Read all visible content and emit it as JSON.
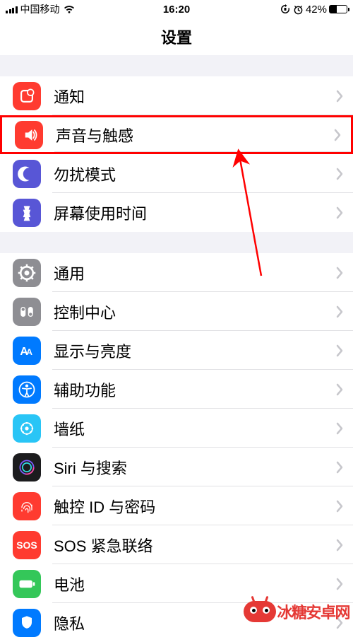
{
  "statusBar": {
    "carrier": "中国移动",
    "time": "16:20",
    "batteryText": "42%"
  },
  "navTitle": "设置",
  "groups": [
    {
      "items": [
        {
          "key": "notifications",
          "label": "通知",
          "bg": "#ff3b30"
        },
        {
          "key": "sounds",
          "label": "声音与触感",
          "bg": "#ff3b30",
          "highlighted": true
        },
        {
          "key": "dnd",
          "label": "勿扰模式",
          "bg": "#5856d6"
        },
        {
          "key": "screentime",
          "label": "屏幕使用时间",
          "bg": "#5856d6"
        }
      ]
    },
    {
      "items": [
        {
          "key": "general",
          "label": "通用",
          "bg": "#8e8e93"
        },
        {
          "key": "controlcenter",
          "label": "控制中心",
          "bg": "#8e8e93"
        },
        {
          "key": "display",
          "label": "显示与亮度",
          "bg": "#007aff"
        },
        {
          "key": "accessibility",
          "label": "辅助功能",
          "bg": "#007aff"
        },
        {
          "key": "wallpaper",
          "label": "墙纸",
          "bg": "#29c5f6"
        },
        {
          "key": "siri",
          "label": "Siri 与搜索",
          "bg": "#222"
        },
        {
          "key": "touchid",
          "label": "触控 ID 与密码",
          "bg": "#ff3b30"
        },
        {
          "key": "sos",
          "label": "SOS 紧急联络",
          "bg": "#ff3b30"
        },
        {
          "key": "battery",
          "label": "电池",
          "bg": "#34c759"
        },
        {
          "key": "privacy",
          "label": "隐私",
          "bg": "#007aff"
        }
      ]
    }
  ],
  "watermark": {
    "text": "冰糖安卓网"
  }
}
